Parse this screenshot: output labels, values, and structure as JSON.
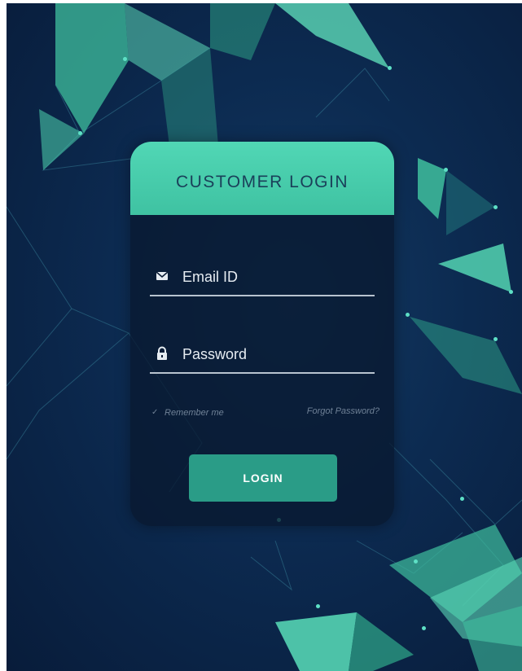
{
  "login_card": {
    "title": "CUSTOMER LOGIN",
    "email": {
      "placeholder": "Email ID",
      "value": "",
      "icon": "envelope-icon"
    },
    "password": {
      "placeholder": "Password",
      "value": "",
      "icon": "lock-icon"
    },
    "remember_label": "Remember me",
    "remember_checked": true,
    "forgot_label": "Forgot Password?",
    "login_label": "LOGIN"
  },
  "colors": {
    "accent": "#46c9a8",
    "button": "#2a9c87",
    "background": "#0c2a50",
    "title_text": "#1a3f59"
  }
}
